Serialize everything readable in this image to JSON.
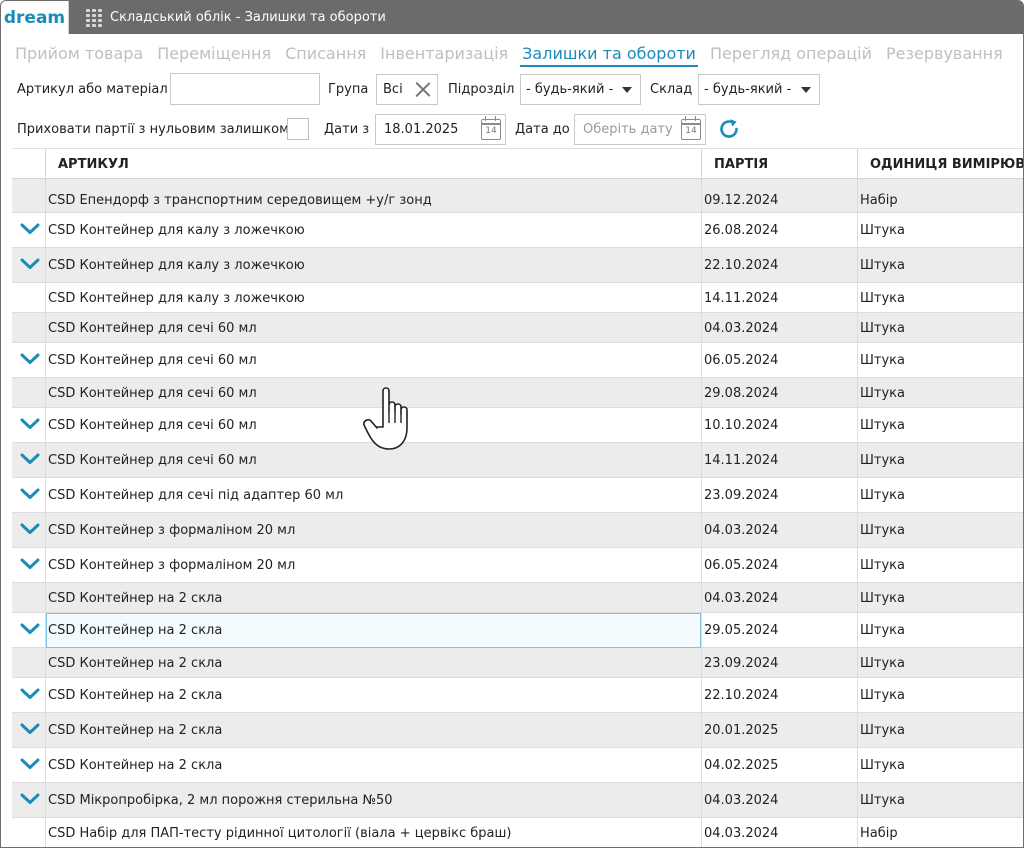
{
  "window": {
    "logo": "dream",
    "title": "Складський облік - Залишки та обороти"
  },
  "tabs": [
    {
      "label": "Прийом товара",
      "active": false
    },
    {
      "label": "Переміщення",
      "active": false
    },
    {
      "label": "Списання",
      "active": false
    },
    {
      "label": "Інвентаризація",
      "active": false
    },
    {
      "label": "Залишки та обороти",
      "active": true
    },
    {
      "label": "Перегляд операцій",
      "active": false
    },
    {
      "label": "Резервування",
      "active": false
    }
  ],
  "filters": {
    "article_label": "Артикул або матеріал",
    "article_value": "",
    "group_label": "Група",
    "group_value": "Всі",
    "division_label": "Підрозділ",
    "division_value": "- будь-який -",
    "warehouse_label": "Склад",
    "warehouse_value": "- будь-який -",
    "hide_zero_label": "Приховати партії з нульовим залишком",
    "hide_zero_checked": false,
    "date_from_label": "Дати з",
    "date_from_value": "18.01.2025",
    "date_to_label": "Дата до",
    "date_to_placeholder": "Оберіть дату",
    "calendar_day": "14"
  },
  "grid": {
    "columns": [
      "АРТИКУЛ",
      "ПАРТІЯ",
      "ОДИНИЦЯ ВИМІРЮВАННЯ"
    ],
    "rows": [
      {
        "article": "CSD Епендорф з транспортним середовищем +у/г зонд",
        "batch": "09.12.2024",
        "unit": "Набір",
        "expand": false
      },
      {
        "article": "CSD Контейнер для калу з ложечкою",
        "batch": "26.08.2024",
        "unit": "Штука",
        "expand": true
      },
      {
        "article": "CSD Контейнер для калу з ложечкою",
        "batch": "22.10.2024",
        "unit": "Штука",
        "expand": true
      },
      {
        "article": "CSD Контейнер для калу з ложечкою",
        "batch": "14.11.2024",
        "unit": "Штука",
        "expand": false
      },
      {
        "article": "CSD Контейнер для сечі 60 мл",
        "batch": "04.03.2024",
        "unit": "Штука",
        "expand": false
      },
      {
        "article": "CSD Контейнер для сечі 60 мл",
        "batch": "06.05.2024",
        "unit": "Штука",
        "expand": true
      },
      {
        "article": "CSD Контейнер для сечі 60 мл",
        "batch": "29.08.2024",
        "unit": "Штука",
        "expand": false
      },
      {
        "article": "CSD Контейнер для сечі 60 мл",
        "batch": "10.10.2024",
        "unit": "Штука",
        "expand": true
      },
      {
        "article": "CSD Контейнер для сечі 60 мл",
        "batch": "14.11.2024",
        "unit": "Штука",
        "expand": true
      },
      {
        "article": "CSD Контейнер для сечі під адаптер 60 мл",
        "batch": "23.09.2024",
        "unit": "Штука",
        "expand": true
      },
      {
        "article": "CSD Контейнер з формаліном 20 мл",
        "batch": "04.03.2024",
        "unit": "Штука",
        "expand": true
      },
      {
        "article": "CSD Контейнер з формаліном 20 мл",
        "batch": "06.05.2024",
        "unit": "Штука",
        "expand": true
      },
      {
        "article": "CSD Контейнер на 2 скла",
        "batch": "04.03.2024",
        "unit": "Штука",
        "expand": false
      },
      {
        "article": "CSD Контейнер на 2 скла",
        "batch": "29.05.2024",
        "unit": "Штука",
        "expand": true,
        "selected": true
      },
      {
        "article": "CSD Контейнер на 2 скла",
        "batch": "23.09.2024",
        "unit": "Штука",
        "expand": false
      },
      {
        "article": "CSD Контейнер на 2 скла",
        "batch": "22.10.2024",
        "unit": "Штука",
        "expand": true
      },
      {
        "article": "CSD Контейнер на 2 скла",
        "batch": "20.01.2025",
        "unit": "Штука",
        "expand": true
      },
      {
        "article": "CSD Контейнер на 2 скла",
        "batch": "04.02.2025",
        "unit": "Штука",
        "expand": true
      },
      {
        "article": "CSD Мікропробірка, 2  мл порожня стерильна №50",
        "batch": "04.03.2024",
        "unit": "Штука",
        "expand": true
      },
      {
        "article": "CSD Набір для ПАП-тесту рідинної цитології (віала + цервікс браш)",
        "batch": "04.03.2024",
        "unit": "Набір",
        "expand": false
      }
    ]
  },
  "colors": {
    "accent": "#1a8cb8",
    "titlebar": "#6b6b6b",
    "row_alt": "#ececec"
  }
}
